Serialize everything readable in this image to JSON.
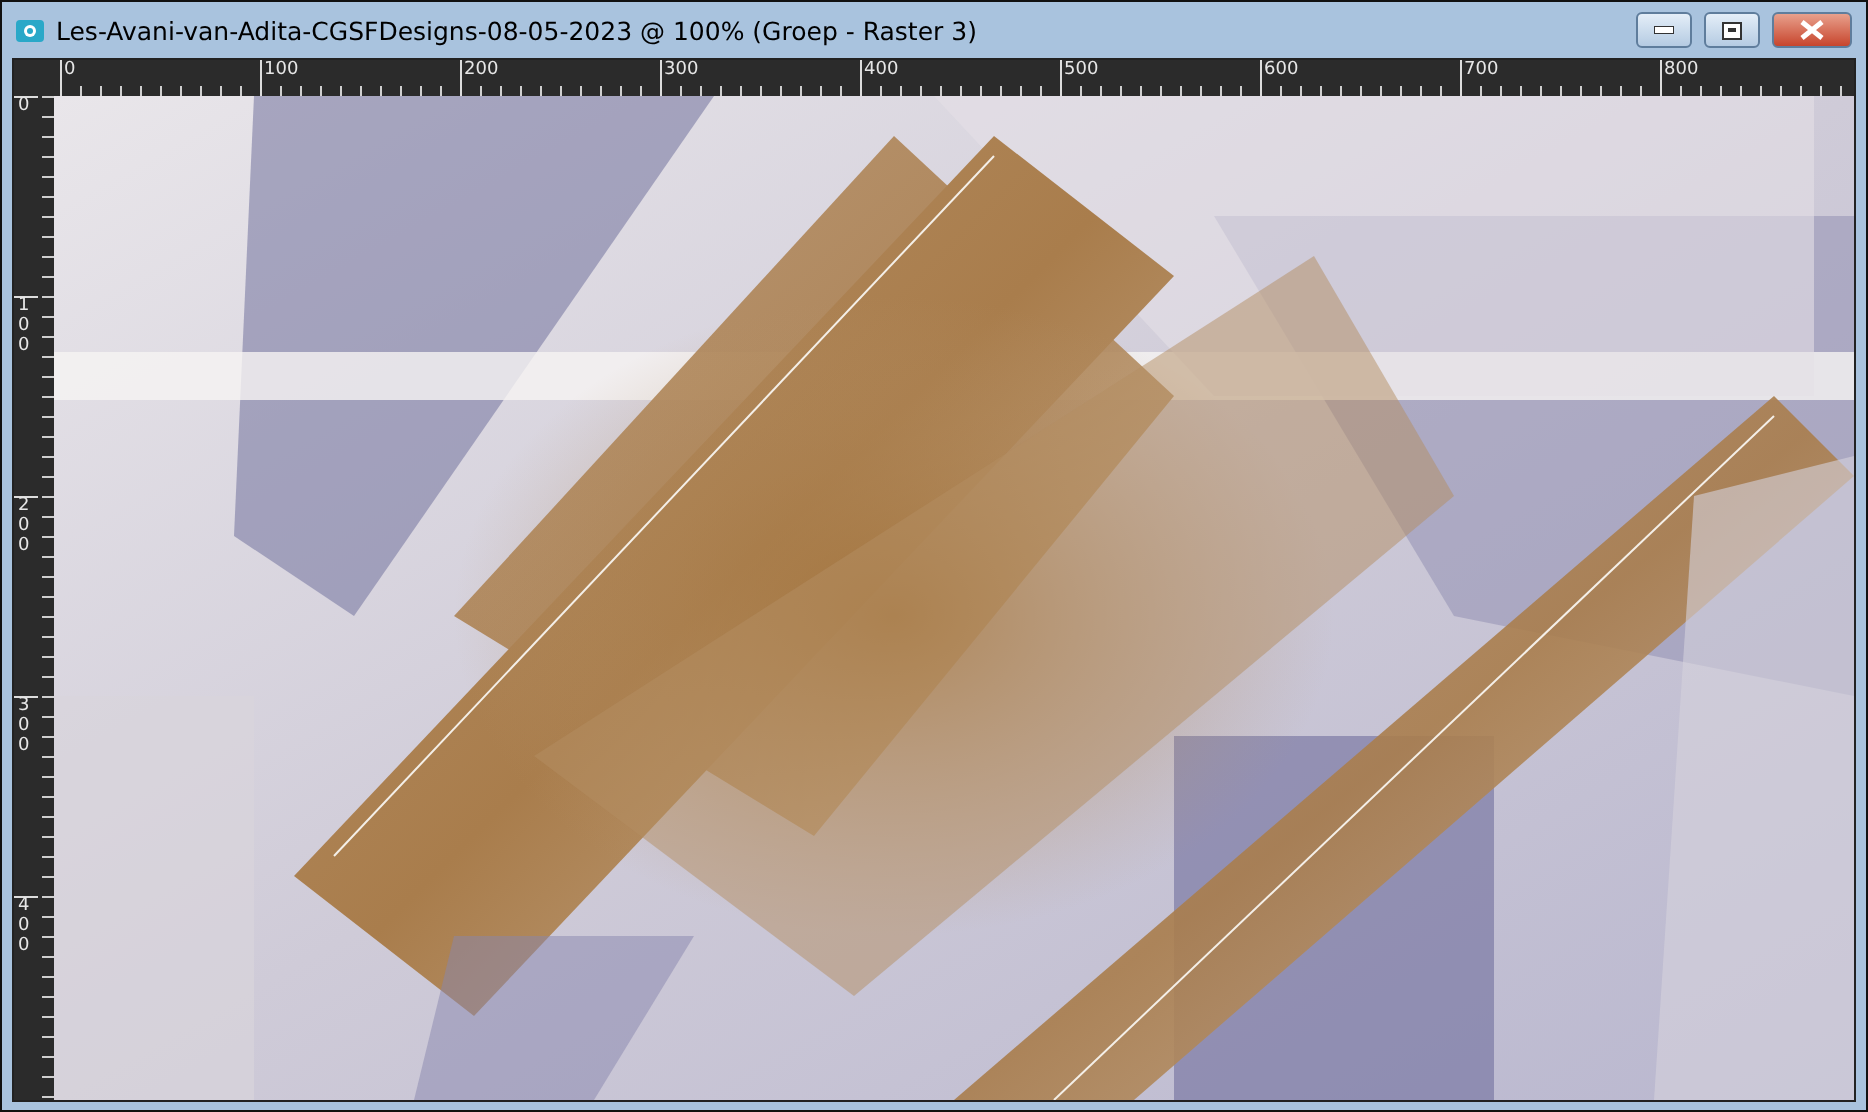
{
  "window": {
    "title": "Les-Avani-van-Adita-CGSFDesigns-08-05-2023 @ 100% (Groep - Raster 3)"
  },
  "rulers": {
    "horizontal": [
      "0",
      "100",
      "200",
      "300",
      "400",
      "500",
      "600",
      "700",
      "800"
    ],
    "vertical": [
      "0",
      "100",
      "200",
      "300",
      "400"
    ]
  }
}
